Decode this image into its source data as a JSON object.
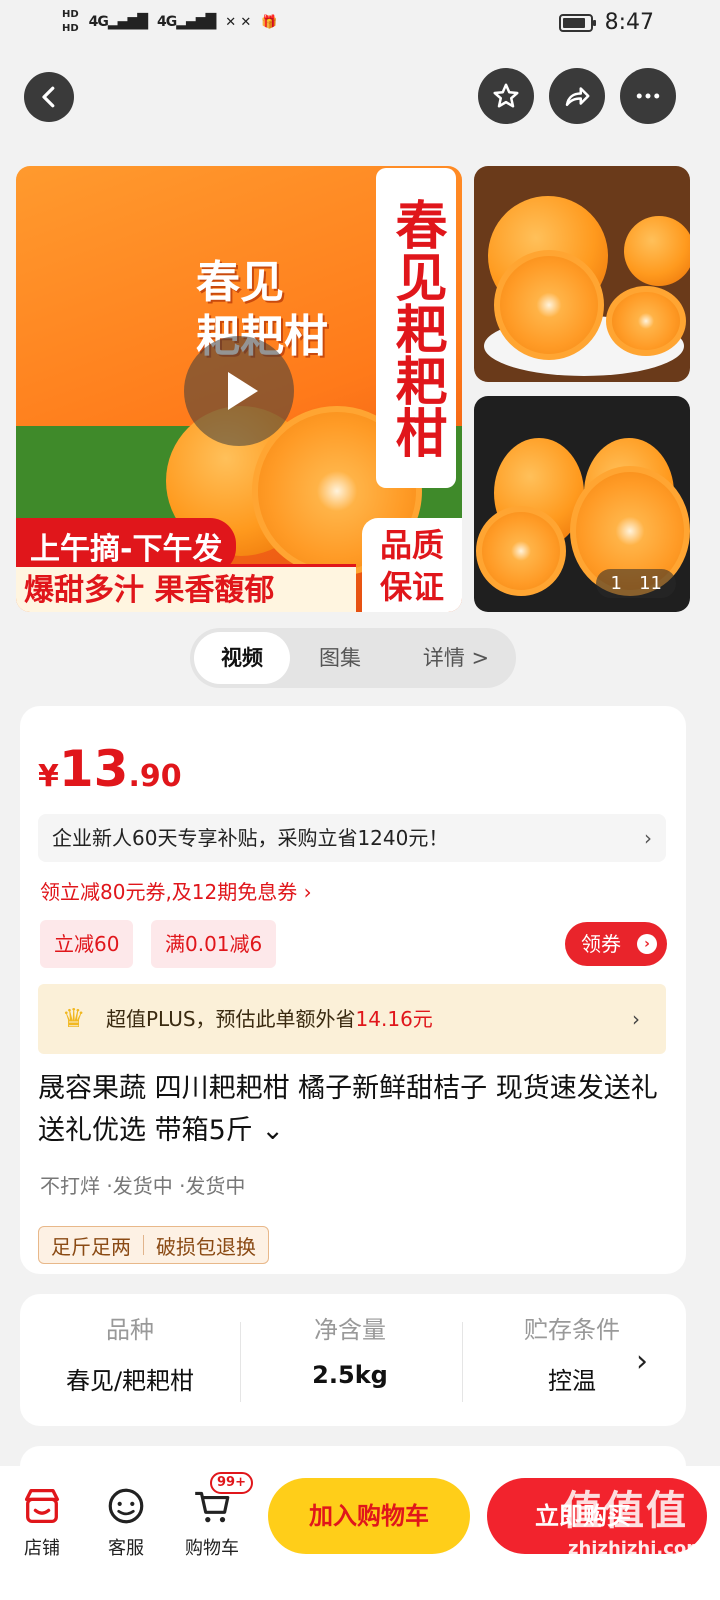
{
  "status_bar": {
    "left_icons": [
      "HD",
      "HD",
      "4G",
      "4G",
      "1↓1↑"
    ],
    "time": "8:47"
  },
  "header": {
    "back_icon": "chevron-left-icon",
    "favorite_icon": "star-icon",
    "share_icon": "share-icon",
    "more_icon": "more-icon"
  },
  "gallery": {
    "vertical_title": "春见耙耙柑",
    "box_title_line1": "春见",
    "box_title_line2": "耙耙柑",
    "banner_1": "上午摘-下午发",
    "banner_2": "爆甜多汁 果香馥郁",
    "quality_1": "品质",
    "quality_2": "保证",
    "counter_current": "1",
    "counter_total": "11"
  },
  "media_tabs": [
    {
      "label": "视频"
    },
    {
      "label": "图集"
    },
    {
      "label": "详情 >"
    }
  ],
  "product": {
    "price_symbol": "¥",
    "price_integer": "13",
    "price_decimal": ".90",
    "subsidy_text": "企业新人60天专享补贴，采购立省1240元！",
    "subsidy_arrow": "›",
    "coupon_link": "领立减80元券,及12期免息券 ›",
    "promo_tags": [
      "立减60",
      "满0.01减6"
    ],
    "get_coupon_label": "领券",
    "plus_text": "超值PLUS，预估此单额外省",
    "plus_amount": "14.16元",
    "title": "晟容果蔬 四川耙耙柑 橘子新鲜甜桔子 现货速发送礼送礼优选 带箱5斤 ⌄",
    "shipping": "不打烊 ·发货中 ·发货中",
    "service_tags": [
      "足斤足两",
      "破损包退换"
    ]
  },
  "specs": [
    {
      "key": "品种",
      "value": "春见/耙耙柑"
    },
    {
      "key": "净含量",
      "value": "2.5kg"
    },
    {
      "key": "贮存条件",
      "value": "控温"
    }
  ],
  "bottom_bar": {
    "store_label": "店铺",
    "service_label": "客服",
    "cart_label": "购物车",
    "cart_badge": "99+",
    "add_to_cart": "加入购物车",
    "buy_now": "立即购买"
  },
  "watermark": {
    "text": "值值值",
    "url": "zhizhizhi.com"
  }
}
